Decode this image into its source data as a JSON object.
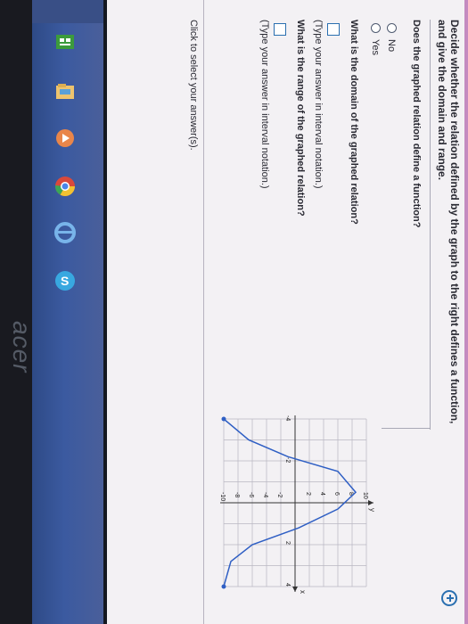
{
  "page": {
    "instruction": "Decide whether the relation defined by the graph to the right defines a function, and give the domain and range.",
    "question_function": "Does the graphed relation define a function?",
    "options": [
      "No",
      "Yes"
    ],
    "question_domain": "What is the domain of the graphed relation?",
    "hint_domain": "(Type your answer in interval notation.)",
    "question_range": "What is the range of the graphed relation?",
    "hint_range": "(Type your answer in interval notation.)",
    "footer": "Click to select your answer(s)."
  },
  "chart_data": {
    "type": "line",
    "xlabel": "x",
    "ylabel": "y",
    "xlim": [
      -4,
      4
    ],
    "ylim": [
      -10,
      10
    ],
    "x_ticks": [
      "-4",
      "-2",
      "2",
      "4"
    ],
    "y_ticks": [
      "10",
      "8",
      "6",
      "4",
      "2",
      "-2",
      "-4",
      "-6",
      "-8",
      "-10"
    ],
    "grid": true,
    "series": [
      {
        "x": [
          -4,
          -3,
          -2.2,
          -1.5,
          -0.5,
          0.3,
          1.2,
          2.0,
          2.8,
          4
        ],
        "y": [
          -10,
          -6.5,
          -1,
          6,
          8.5,
          6,
          0.5,
          -6,
          -9,
          -10
        ]
      }
    ],
    "arrows": "both-ends"
  },
  "taskbar": {
    "brand": "acer",
    "icons": [
      "store-icon",
      "file-explorer-icon",
      "media-player-icon",
      "chrome-icon",
      "ie-icon",
      "skype-icon"
    ]
  }
}
